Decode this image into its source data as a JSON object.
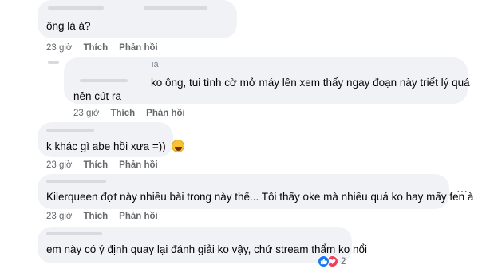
{
  "comments": [
    {
      "text": "ông là           à?",
      "time": "23 giờ",
      "like_label": "Thích",
      "reply_label": "Phản hồi"
    },
    {
      "author_tail": "ià",
      "line1": "ko ông, tui tình cờ mở máy lên xem thấy ngay đoạn này triết lý quá",
      "line2": "nên cút ra",
      "time": "23 giờ",
      "like_label": "Thích",
      "reply_label": "Phản hồi"
    },
    {
      "text": "k khác gì abe hồi xưa =))",
      "emoji": "grinning-face-emoji",
      "time": "23 giờ",
      "like_label": "Thích",
      "reply_label": "Phản hồi"
    },
    {
      "text": "Kilerqueen đợt này nhiều bài trong này thế... Tôi thấy oke mà nhiều quá ko hay mấy fen à",
      "time": "23 giờ",
      "like_label": "Thích",
      "reply_label": "Phản hồi",
      "more_icon": "more-dots-icon"
    },
    {
      "text": "em này có ý định quay lại đánh giải ko vậy, chứ stream thẩm ko nổi",
      "reaction_count": "2",
      "reaction_icons": [
        "like-icon",
        "heart-icon"
      ]
    }
  ],
  "colors": {
    "bubble": "#f0f2f5",
    "meta": "#65676b",
    "like_blue": "#1877f2",
    "heart_red": "#f33e58"
  }
}
